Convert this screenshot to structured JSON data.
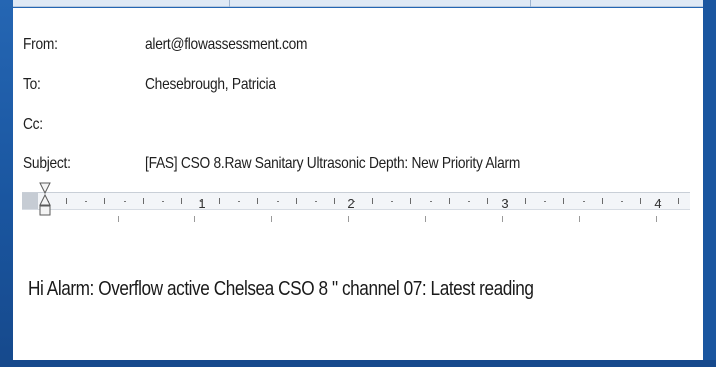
{
  "window": {
    "background": "#1d5ba6",
    "panel_background": "#ffffff"
  },
  "header": {
    "from_label": "From:",
    "from_value": "alert@flowassessment.com",
    "to_label": "To:",
    "to_value": "Chesebrough, Patricia",
    "cc_label": "Cc:",
    "cc_value": "",
    "subject_label": "Subject:",
    "subject_value": "[FAS] CSO 8.Raw Sanitary Ultrasonic Depth: New Priority Alarm"
  },
  "ruler": {
    "numbers": [
      "1",
      "2",
      "3",
      "4"
    ]
  },
  "body": {
    "text": "Hi Alarm: Overflow active Chelsea CSO 8 \" channel  07: Latest reading"
  },
  "icons": {
    "indent_marker": "hourglass-indent-icon"
  }
}
